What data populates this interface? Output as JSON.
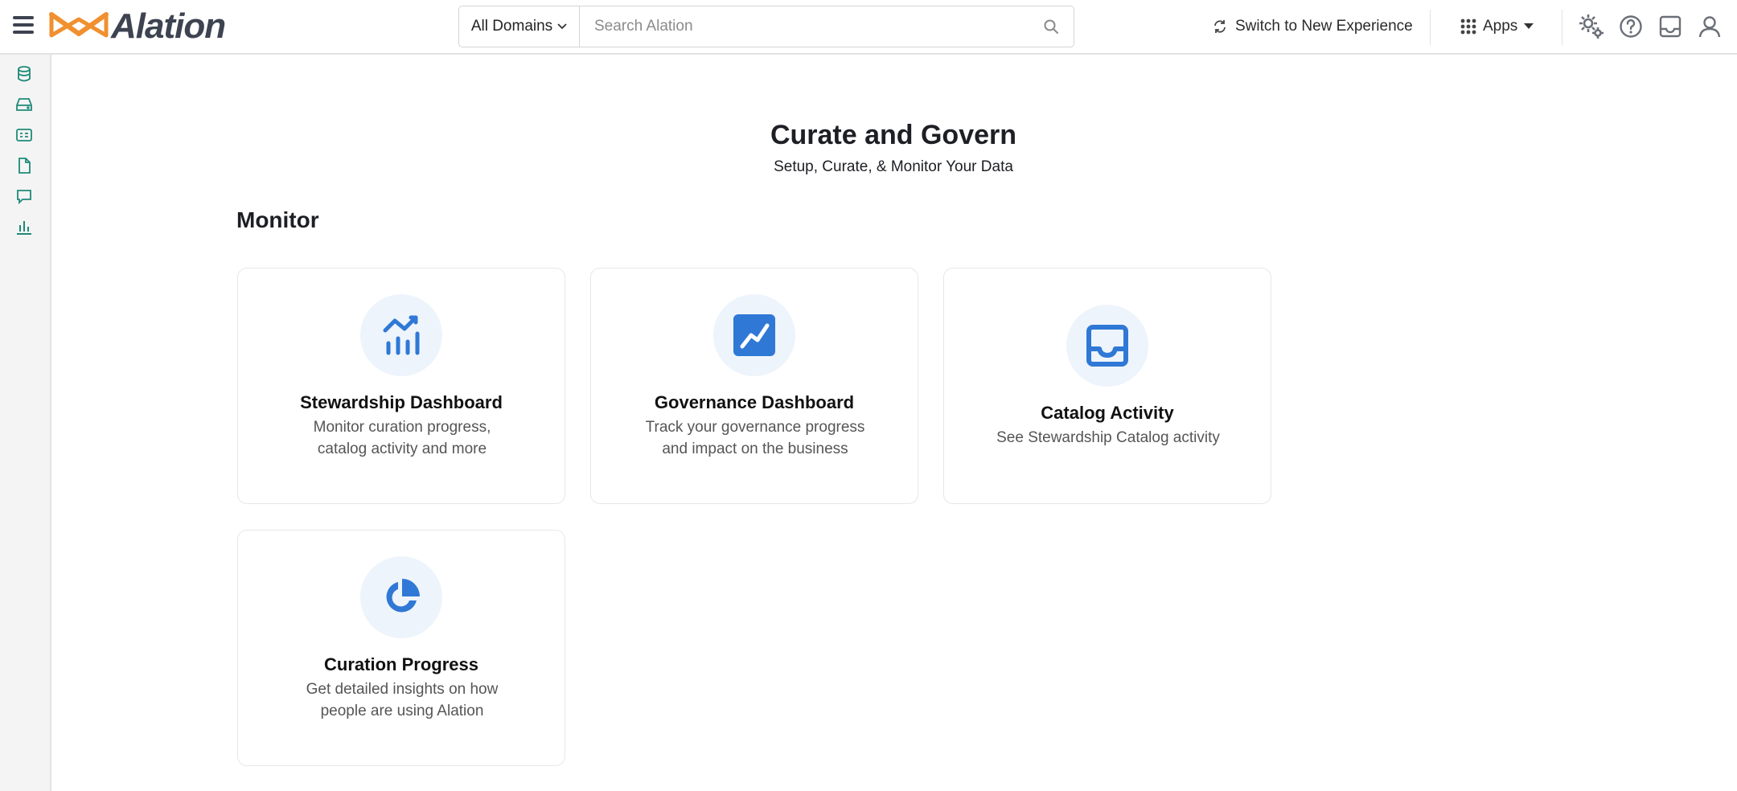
{
  "header": {
    "logo_text": "Alation",
    "domain_select": "All Domains",
    "search_placeholder": "Search Alation",
    "switch_label": "Switch to New Experience",
    "apps_label": "Apps",
    "brand_orange": "#f0902f",
    "brand_dark": "#3d4350"
  },
  "sidebar": {
    "items": [
      {
        "icon": "database-icon"
      },
      {
        "icon": "inbox-tray-icon"
      },
      {
        "icon": "catalog-card-icon"
      },
      {
        "icon": "document-icon"
      },
      {
        "icon": "conversation-icon"
      },
      {
        "icon": "bar-chart-icon"
      }
    ],
    "icon_color": "#1f8a78"
  },
  "main": {
    "title": "Curate and Govern",
    "subtitle": "Setup, Curate, & Monitor Your Data",
    "section_title": "Monitor",
    "cards": [
      {
        "title": "Stewardship Dashboard",
        "desc_line1": "Monitor curation progress,",
        "desc_line2": "catalog activity and more",
        "icon": "analytics-chart-icon"
      },
      {
        "title": "Governance Dashboard",
        "desc_line1": "Track your governance progress",
        "desc_line2": "and impact on the business",
        "icon": "trend-line-icon"
      },
      {
        "title": "Catalog Activity",
        "desc_line1": "See Stewardship Catalog activity",
        "desc_line2": "",
        "icon": "inbox-icon"
      },
      {
        "title": "Curation Progress",
        "desc_line1": "Get detailed insights on how",
        "desc_line2": "people are using Alation",
        "icon": "pie-chart-icon"
      }
    ],
    "accent": "#2f78d6"
  }
}
